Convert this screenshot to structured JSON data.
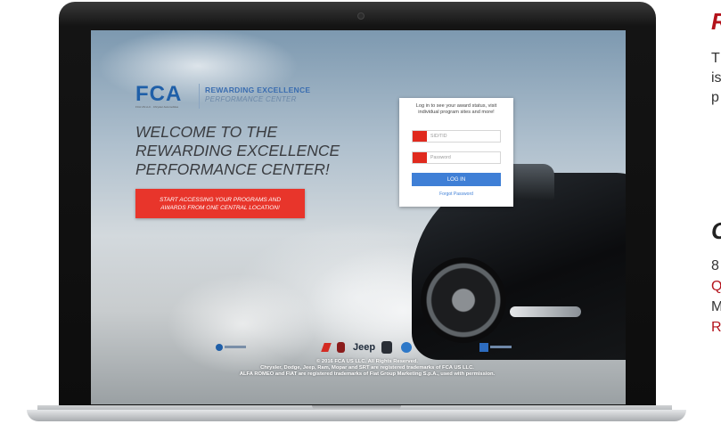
{
  "hero": {
    "fca_logo_text": "FCA",
    "fca_tagline": "FCA US LLC · Chrysler Automobiles",
    "program_title": "REWARDING EXCELLENCE",
    "program_subtitle": "PERFORMANCE CENTER",
    "welcome": "WELCOME TO THE\nREWARDING EXCELLENCE\nPERFORMANCE CENTER!",
    "cta": "START ACCESSING YOUR PROGRAMS AND\nAWARDS FROM ONE CENTRAL LOCATION!"
  },
  "login": {
    "intro": "Log in to see your award status, visit\nindividual program sites and more!",
    "sid_placeholder": "SID/TID",
    "password_placeholder": "Password",
    "button_label": "LOG IN",
    "forgot_label": "Forgot Password"
  },
  "brands": {
    "jeep": "Jeep"
  },
  "footer": {
    "text": "© 2016 FCA US LLC. All Rights Reserved.\nChrysler, Dodge, Jeep, Ram, Mopar and SRT are registered trademarks of FCA US LLC.\nALFA ROMEO and FIAT are registered trademarks of Fiat Group Marketing S.p.A., used with permission."
  },
  "side": {
    "heading1": "R",
    "para_lines": [
      "T",
      "is",
      "p"
    ],
    "heading2": "C",
    "line1": "8",
    "link1": "Q",
    "line2": "M",
    "link2": "R"
  },
  "colors": {
    "brand_red": "#e8352b",
    "login_blue": "#3f7fd6",
    "fca_blue": "#1f5fa8",
    "side_red": "#b4121b"
  }
}
